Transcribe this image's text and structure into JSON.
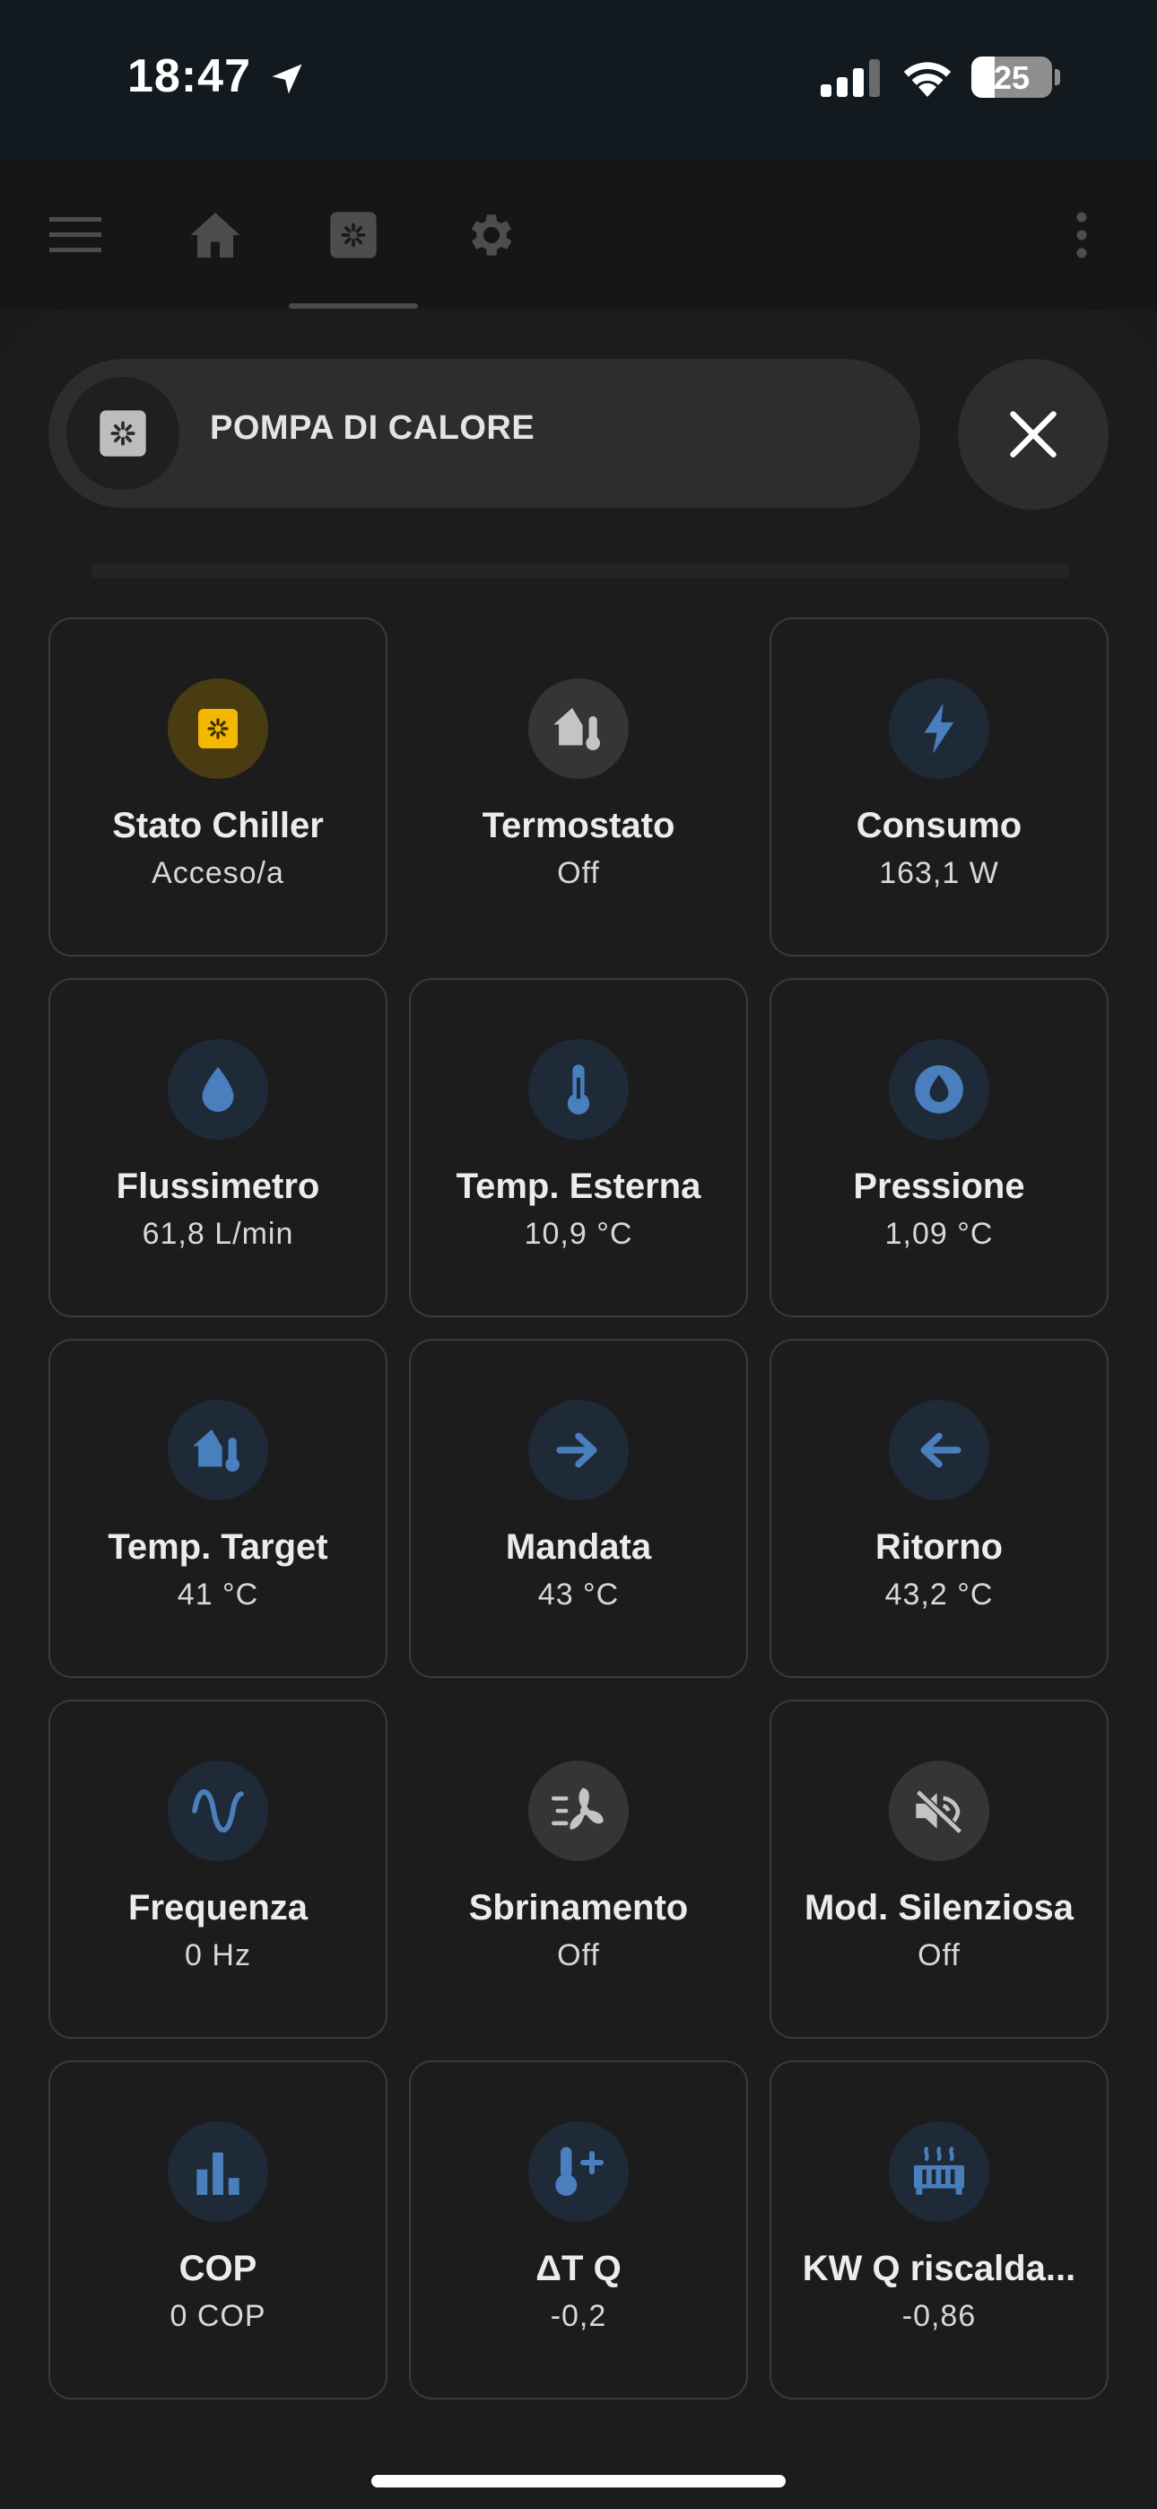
{
  "status_bar": {
    "time": "18:47",
    "battery": "25",
    "icons": [
      "location-arrow-icon",
      "cellular-signal-icon",
      "wifi-icon",
      "battery-icon"
    ]
  },
  "toolbar": {
    "icons": [
      "menu-icon",
      "home-icon",
      "heat-pump-icon",
      "gear-icon",
      "more-vert-icon"
    ]
  },
  "header": {
    "title": "POMPA DI CALORE",
    "icon": "heat-pump-icon",
    "close_icon": "close-icon"
  },
  "colors": {
    "accent_blue": "#4a7fbd",
    "accent_yellow": "#f5b800",
    "icon_grey": "#c4c4c4"
  },
  "tiles": [
    {
      "name": "Stato Chiller",
      "value": "Acceso/a",
      "icon": "heat-pump-icon"
    },
    {
      "name": "Termostato",
      "value": "Off",
      "icon": "home-thermometer-icon"
    },
    {
      "name": "Consumo",
      "value": "163,1 W",
      "icon": "flash-icon"
    },
    {
      "name": "Flussimetro",
      "value": "61,8 L/min",
      "icon": "water-drop-icon"
    },
    {
      "name": "Temp. Esterna",
      "value": "10,9 °C",
      "icon": "thermometer-icon"
    },
    {
      "name": "Pressione",
      "value": "1,09 °C",
      "icon": "water-circle-icon"
    },
    {
      "name": "Temp. Target",
      "value": "41 °C",
      "icon": "home-thermometer-icon"
    },
    {
      "name": "Mandata",
      "value": "43 °C",
      "icon": "arrow-right-icon"
    },
    {
      "name": "Ritorno",
      "value": "43,2 °C",
      "icon": "arrow-left-icon"
    },
    {
      "name": "Frequenza",
      "value": "0 Hz",
      "icon": "sine-wave-icon"
    },
    {
      "name": "Sbrinamento",
      "value": "Off",
      "icon": "fan-defrost-icon"
    },
    {
      "name": "Mod. Silenziosa",
      "value": "Off",
      "icon": "volume-off-icon"
    },
    {
      "name": "COP",
      "value": "0 COP",
      "icon": "bar-chart-icon"
    },
    {
      "name": "ΔT Q",
      "value": "-0,2",
      "icon": "thermometer-plus-icon"
    },
    {
      "name": "KW Q riscalda...",
      "value": "-0,86",
      "icon": "radiator-icon"
    }
  ]
}
